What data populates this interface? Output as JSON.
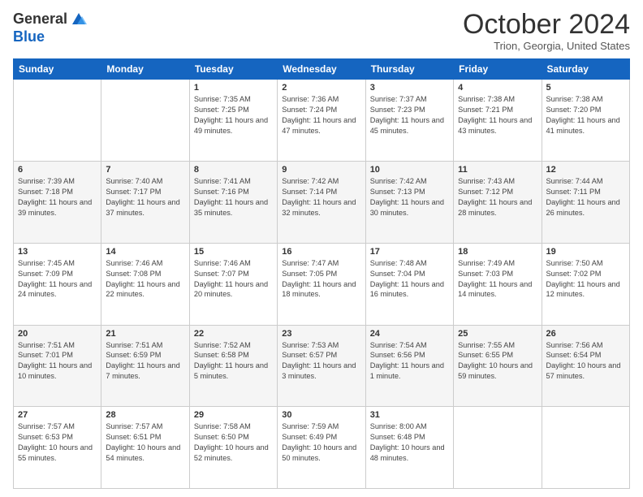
{
  "header": {
    "logo_general": "General",
    "logo_blue": "Blue",
    "month": "October 2024",
    "location": "Trion, Georgia, United States"
  },
  "days_of_week": [
    "Sunday",
    "Monday",
    "Tuesday",
    "Wednesday",
    "Thursday",
    "Friday",
    "Saturday"
  ],
  "weeks": [
    [
      {
        "day": "",
        "sunrise": "",
        "sunset": "",
        "daylight": ""
      },
      {
        "day": "",
        "sunrise": "",
        "sunset": "",
        "daylight": ""
      },
      {
        "day": "1",
        "sunrise": "Sunrise: 7:35 AM",
        "sunset": "Sunset: 7:25 PM",
        "daylight": "Daylight: 11 hours and 49 minutes."
      },
      {
        "day": "2",
        "sunrise": "Sunrise: 7:36 AM",
        "sunset": "Sunset: 7:24 PM",
        "daylight": "Daylight: 11 hours and 47 minutes."
      },
      {
        "day": "3",
        "sunrise": "Sunrise: 7:37 AM",
        "sunset": "Sunset: 7:23 PM",
        "daylight": "Daylight: 11 hours and 45 minutes."
      },
      {
        "day": "4",
        "sunrise": "Sunrise: 7:38 AM",
        "sunset": "Sunset: 7:21 PM",
        "daylight": "Daylight: 11 hours and 43 minutes."
      },
      {
        "day": "5",
        "sunrise": "Sunrise: 7:38 AM",
        "sunset": "Sunset: 7:20 PM",
        "daylight": "Daylight: 11 hours and 41 minutes."
      }
    ],
    [
      {
        "day": "6",
        "sunrise": "Sunrise: 7:39 AM",
        "sunset": "Sunset: 7:18 PM",
        "daylight": "Daylight: 11 hours and 39 minutes."
      },
      {
        "day": "7",
        "sunrise": "Sunrise: 7:40 AM",
        "sunset": "Sunset: 7:17 PM",
        "daylight": "Daylight: 11 hours and 37 minutes."
      },
      {
        "day": "8",
        "sunrise": "Sunrise: 7:41 AM",
        "sunset": "Sunset: 7:16 PM",
        "daylight": "Daylight: 11 hours and 35 minutes."
      },
      {
        "day": "9",
        "sunrise": "Sunrise: 7:42 AM",
        "sunset": "Sunset: 7:14 PM",
        "daylight": "Daylight: 11 hours and 32 minutes."
      },
      {
        "day": "10",
        "sunrise": "Sunrise: 7:42 AM",
        "sunset": "Sunset: 7:13 PM",
        "daylight": "Daylight: 11 hours and 30 minutes."
      },
      {
        "day": "11",
        "sunrise": "Sunrise: 7:43 AM",
        "sunset": "Sunset: 7:12 PM",
        "daylight": "Daylight: 11 hours and 28 minutes."
      },
      {
        "day": "12",
        "sunrise": "Sunrise: 7:44 AM",
        "sunset": "Sunset: 7:11 PM",
        "daylight": "Daylight: 11 hours and 26 minutes."
      }
    ],
    [
      {
        "day": "13",
        "sunrise": "Sunrise: 7:45 AM",
        "sunset": "Sunset: 7:09 PM",
        "daylight": "Daylight: 11 hours and 24 minutes."
      },
      {
        "day": "14",
        "sunrise": "Sunrise: 7:46 AM",
        "sunset": "Sunset: 7:08 PM",
        "daylight": "Daylight: 11 hours and 22 minutes."
      },
      {
        "day": "15",
        "sunrise": "Sunrise: 7:46 AM",
        "sunset": "Sunset: 7:07 PM",
        "daylight": "Daylight: 11 hours and 20 minutes."
      },
      {
        "day": "16",
        "sunrise": "Sunrise: 7:47 AM",
        "sunset": "Sunset: 7:05 PM",
        "daylight": "Daylight: 11 hours and 18 minutes."
      },
      {
        "day": "17",
        "sunrise": "Sunrise: 7:48 AM",
        "sunset": "Sunset: 7:04 PM",
        "daylight": "Daylight: 11 hours and 16 minutes."
      },
      {
        "day": "18",
        "sunrise": "Sunrise: 7:49 AM",
        "sunset": "Sunset: 7:03 PM",
        "daylight": "Daylight: 11 hours and 14 minutes."
      },
      {
        "day": "19",
        "sunrise": "Sunrise: 7:50 AM",
        "sunset": "Sunset: 7:02 PM",
        "daylight": "Daylight: 11 hours and 12 minutes."
      }
    ],
    [
      {
        "day": "20",
        "sunrise": "Sunrise: 7:51 AM",
        "sunset": "Sunset: 7:01 PM",
        "daylight": "Daylight: 11 hours and 10 minutes."
      },
      {
        "day": "21",
        "sunrise": "Sunrise: 7:51 AM",
        "sunset": "Sunset: 6:59 PM",
        "daylight": "Daylight: 11 hours and 7 minutes."
      },
      {
        "day": "22",
        "sunrise": "Sunrise: 7:52 AM",
        "sunset": "Sunset: 6:58 PM",
        "daylight": "Daylight: 11 hours and 5 minutes."
      },
      {
        "day": "23",
        "sunrise": "Sunrise: 7:53 AM",
        "sunset": "Sunset: 6:57 PM",
        "daylight": "Daylight: 11 hours and 3 minutes."
      },
      {
        "day": "24",
        "sunrise": "Sunrise: 7:54 AM",
        "sunset": "Sunset: 6:56 PM",
        "daylight": "Daylight: 11 hours and 1 minute."
      },
      {
        "day": "25",
        "sunrise": "Sunrise: 7:55 AM",
        "sunset": "Sunset: 6:55 PM",
        "daylight": "Daylight: 10 hours and 59 minutes."
      },
      {
        "day": "26",
        "sunrise": "Sunrise: 7:56 AM",
        "sunset": "Sunset: 6:54 PM",
        "daylight": "Daylight: 10 hours and 57 minutes."
      }
    ],
    [
      {
        "day": "27",
        "sunrise": "Sunrise: 7:57 AM",
        "sunset": "Sunset: 6:53 PM",
        "daylight": "Daylight: 10 hours and 55 minutes."
      },
      {
        "day": "28",
        "sunrise": "Sunrise: 7:57 AM",
        "sunset": "Sunset: 6:51 PM",
        "daylight": "Daylight: 10 hours and 54 minutes."
      },
      {
        "day": "29",
        "sunrise": "Sunrise: 7:58 AM",
        "sunset": "Sunset: 6:50 PM",
        "daylight": "Daylight: 10 hours and 52 minutes."
      },
      {
        "day": "30",
        "sunrise": "Sunrise: 7:59 AM",
        "sunset": "Sunset: 6:49 PM",
        "daylight": "Daylight: 10 hours and 50 minutes."
      },
      {
        "day": "31",
        "sunrise": "Sunrise: 8:00 AM",
        "sunset": "Sunset: 6:48 PM",
        "daylight": "Daylight: 10 hours and 48 minutes."
      },
      {
        "day": "",
        "sunrise": "",
        "sunset": "",
        "daylight": ""
      },
      {
        "day": "",
        "sunrise": "",
        "sunset": "",
        "daylight": ""
      }
    ]
  ]
}
